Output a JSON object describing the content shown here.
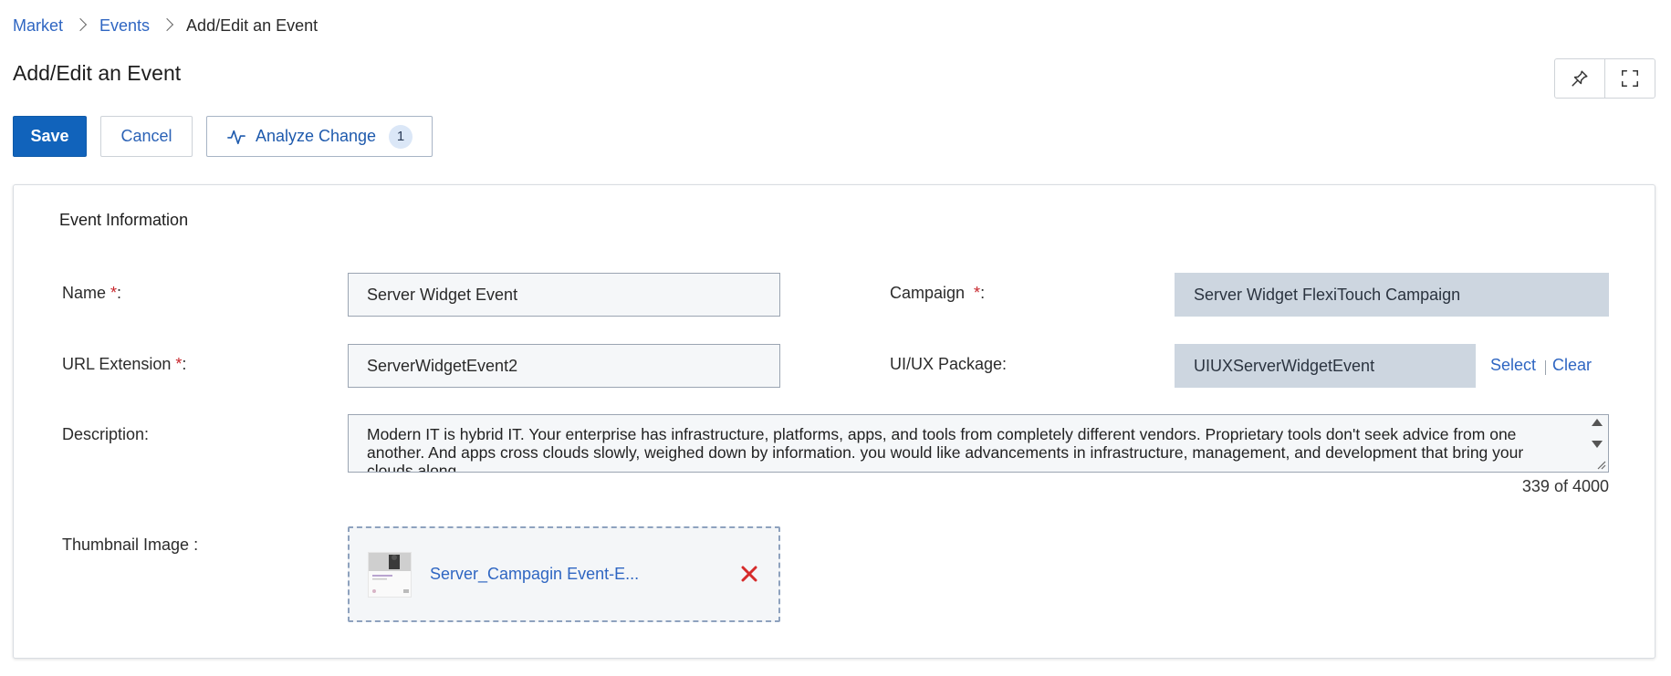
{
  "breadcrumb": {
    "items": [
      {
        "label": "Market"
      },
      {
        "label": "Events"
      },
      {
        "label": "Add/Edit an Event"
      }
    ]
  },
  "page": {
    "title": "Add/Edit an Event"
  },
  "toolbar": {
    "save_label": "Save",
    "cancel_label": "Cancel",
    "analyze_label": "Analyze Change",
    "analyze_count": "1"
  },
  "top_tools": {
    "pin_icon": "pin-icon",
    "expand_icon": "fullscreen-icon"
  },
  "section": {
    "title": "Event Information"
  },
  "form": {
    "name": {
      "label": "Name ",
      "required": "*",
      "suffix": ":",
      "value": "Server Widget Event"
    },
    "campaign": {
      "label": "Campaign ",
      "required": "*",
      "suffix": ":",
      "value": "Server Widget FlexiTouch Campaign"
    },
    "url_extension": {
      "label": "URL Extension ",
      "required": "*",
      "suffix": ":",
      "value": "ServerWidgetEvent2"
    },
    "uiux_package": {
      "label": "UI/UX Package:",
      "value": "UIUXServerWidgetEvent",
      "select_label": "Select",
      "clear_label": "Clear"
    },
    "description": {
      "label": "Description:",
      "value": "Modern IT is hybrid IT. Your enterprise has infrastructure, platforms, apps, and tools from completely different vendors. Proprietary tools don't seek advice from one another. And apps cross clouds slowly, weighed down by information. you would like advancements in infrastructure, management, and development that bring your clouds along.",
      "char_count": "339 of 4000"
    },
    "thumbnail": {
      "label": "Thumbnail Image :",
      "file_name": "Server_Campagin Event-E..."
    }
  },
  "colors": {
    "primary": "#1163bb",
    "link": "#2f66c2",
    "required": "#c7262c",
    "remove": "#d62b2b",
    "readonly_bg": "#cdd6e0"
  }
}
